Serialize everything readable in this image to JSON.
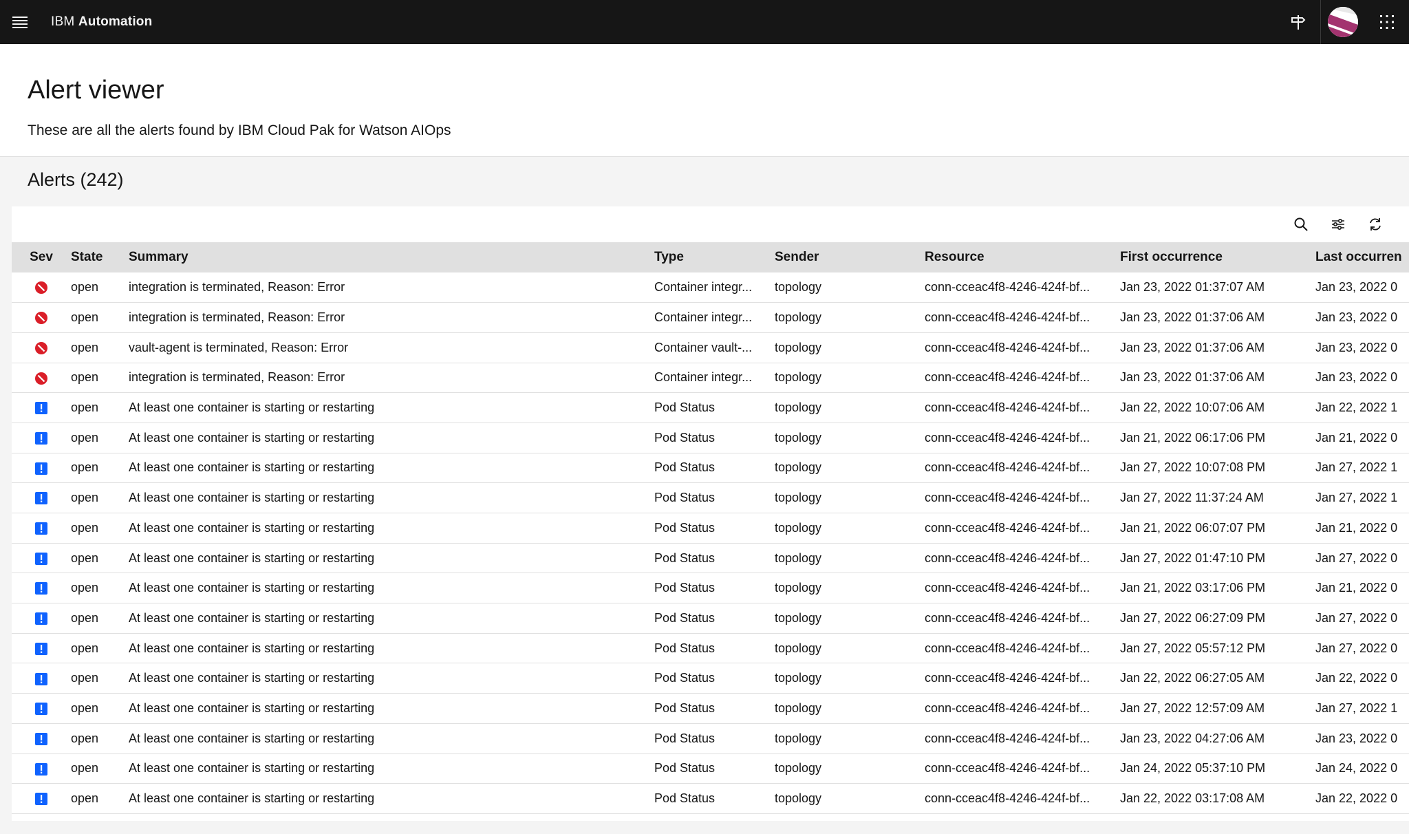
{
  "header": {
    "product_prefix": "IBM",
    "product_name": "Automation"
  },
  "page": {
    "title": "Alert viewer",
    "subtitle": "These are all the alerts found by IBM Cloud Pak for Watson AIOps"
  },
  "alerts": {
    "heading": "Alerts (242)"
  },
  "table": {
    "columns": {
      "sev": "Sev",
      "state": "State",
      "summary": "Summary",
      "type": "Type",
      "sender": "Sender",
      "resource": "Resource",
      "first": "First occurrence",
      "last": "Last occurren"
    },
    "rows": [
      {
        "sev": "critical",
        "state": "open",
        "summary": "integration is terminated, Reason: Error",
        "type": "Container integr...",
        "sender": "topology",
        "resource": "conn-cceac4f8-4246-424f-bf...",
        "first": "Jan 23, 2022 01:37:07 AM",
        "last": "Jan 23, 2022 0"
      },
      {
        "sev": "critical",
        "state": "open",
        "summary": "integration is terminated, Reason: Error",
        "type": "Container integr...",
        "sender": "topology",
        "resource": "conn-cceac4f8-4246-424f-bf...",
        "first": "Jan 23, 2022 01:37:06 AM",
        "last": "Jan 23, 2022 0"
      },
      {
        "sev": "critical",
        "state": "open",
        "summary": "vault-agent is terminated, Reason: Error",
        "type": "Container vault-...",
        "sender": "topology",
        "resource": "conn-cceac4f8-4246-424f-bf...",
        "first": "Jan 23, 2022 01:37:06 AM",
        "last": "Jan 23, 2022 0"
      },
      {
        "sev": "critical",
        "state": "open",
        "summary": "integration is terminated, Reason: Error",
        "type": "Container integr...",
        "sender": "topology",
        "resource": "conn-cceac4f8-4246-424f-bf...",
        "first": "Jan 23, 2022 01:37:06 AM",
        "last": "Jan 23, 2022 0"
      },
      {
        "sev": "warning",
        "state": "open",
        "summary": "At least one container is starting or restarting",
        "type": "Pod Status",
        "sender": "topology",
        "resource": "conn-cceac4f8-4246-424f-bf...",
        "first": "Jan 22, 2022 10:07:06 AM",
        "last": "Jan 22, 2022 1"
      },
      {
        "sev": "warning",
        "state": "open",
        "summary": "At least one container is starting or restarting",
        "type": "Pod Status",
        "sender": "topology",
        "resource": "conn-cceac4f8-4246-424f-bf...",
        "first": "Jan 21, 2022 06:17:06 PM",
        "last": "Jan 21, 2022 0"
      },
      {
        "sev": "warning",
        "state": "open",
        "summary": "At least one container is starting or restarting",
        "type": "Pod Status",
        "sender": "topology",
        "resource": "conn-cceac4f8-4246-424f-bf...",
        "first": "Jan 27, 2022 10:07:08 PM",
        "last": "Jan 27, 2022 1"
      },
      {
        "sev": "warning",
        "state": "open",
        "summary": "At least one container is starting or restarting",
        "type": "Pod Status",
        "sender": "topology",
        "resource": "conn-cceac4f8-4246-424f-bf...",
        "first": "Jan 27, 2022 11:37:24 AM",
        "last": "Jan 27, 2022 1"
      },
      {
        "sev": "warning",
        "state": "open",
        "summary": "At least one container is starting or restarting",
        "type": "Pod Status",
        "sender": "topology",
        "resource": "conn-cceac4f8-4246-424f-bf...",
        "first": "Jan 21, 2022 06:07:07 PM",
        "last": "Jan 21, 2022 0"
      },
      {
        "sev": "warning",
        "state": "open",
        "summary": "At least one container is starting or restarting",
        "type": "Pod Status",
        "sender": "topology",
        "resource": "conn-cceac4f8-4246-424f-bf...",
        "first": "Jan 27, 2022 01:47:10 PM",
        "last": "Jan 27, 2022 0"
      },
      {
        "sev": "warning",
        "state": "open",
        "summary": "At least one container is starting or restarting",
        "type": "Pod Status",
        "sender": "topology",
        "resource": "conn-cceac4f8-4246-424f-bf...",
        "first": "Jan 21, 2022 03:17:06 PM",
        "last": "Jan 21, 2022 0"
      },
      {
        "sev": "warning",
        "state": "open",
        "summary": "At least one container is starting or restarting",
        "type": "Pod Status",
        "sender": "topology",
        "resource": "conn-cceac4f8-4246-424f-bf...",
        "first": "Jan 27, 2022 06:27:09 PM",
        "last": "Jan 27, 2022 0"
      },
      {
        "sev": "warning",
        "state": "open",
        "summary": "At least one container is starting or restarting",
        "type": "Pod Status",
        "sender": "topology",
        "resource": "conn-cceac4f8-4246-424f-bf...",
        "first": "Jan 27, 2022 05:57:12 PM",
        "last": "Jan 27, 2022 0"
      },
      {
        "sev": "warning",
        "state": "open",
        "summary": "At least one container is starting or restarting",
        "type": "Pod Status",
        "sender": "topology",
        "resource": "conn-cceac4f8-4246-424f-bf...",
        "first": "Jan 22, 2022 06:27:05 AM",
        "last": "Jan 22, 2022 0"
      },
      {
        "sev": "warning",
        "state": "open",
        "summary": "At least one container is starting or restarting",
        "type": "Pod Status",
        "sender": "topology",
        "resource": "conn-cceac4f8-4246-424f-bf...",
        "first": "Jan 27, 2022 12:57:09 AM",
        "last": "Jan 27, 2022 1"
      },
      {
        "sev": "warning",
        "state": "open",
        "summary": "At least one container is starting or restarting",
        "type": "Pod Status",
        "sender": "topology",
        "resource": "conn-cceac4f8-4246-424f-bf...",
        "first": "Jan 23, 2022 04:27:06 AM",
        "last": "Jan 23, 2022 0"
      },
      {
        "sev": "warning",
        "state": "open",
        "summary": "At least one container is starting or restarting",
        "type": "Pod Status",
        "sender": "topology",
        "resource": "conn-cceac4f8-4246-424f-bf...",
        "first": "Jan 24, 2022 05:37:10 PM",
        "last": "Jan 24, 2022 0"
      },
      {
        "sev": "warning",
        "state": "open",
        "summary": "At least one container is starting or restarting",
        "type": "Pod Status",
        "sender": "topology",
        "resource": "conn-cceac4f8-4246-424f-bf...",
        "first": "Jan 22, 2022 03:17:08 AM",
        "last": "Jan 22, 2022 0"
      }
    ]
  },
  "colors": {
    "critical": "#da1e28",
    "warning": "#0f62fe",
    "header_bg": "#161616"
  },
  "icons": {
    "menu": "hamburger-menu-icon",
    "guide": "signpost-icon",
    "apps": "app-switcher-icon",
    "search": "search-icon",
    "filter": "settings-adjust-icon",
    "refresh": "refresh-icon",
    "critical": "critical-circle-icon",
    "warning": "warning-square-icon"
  }
}
